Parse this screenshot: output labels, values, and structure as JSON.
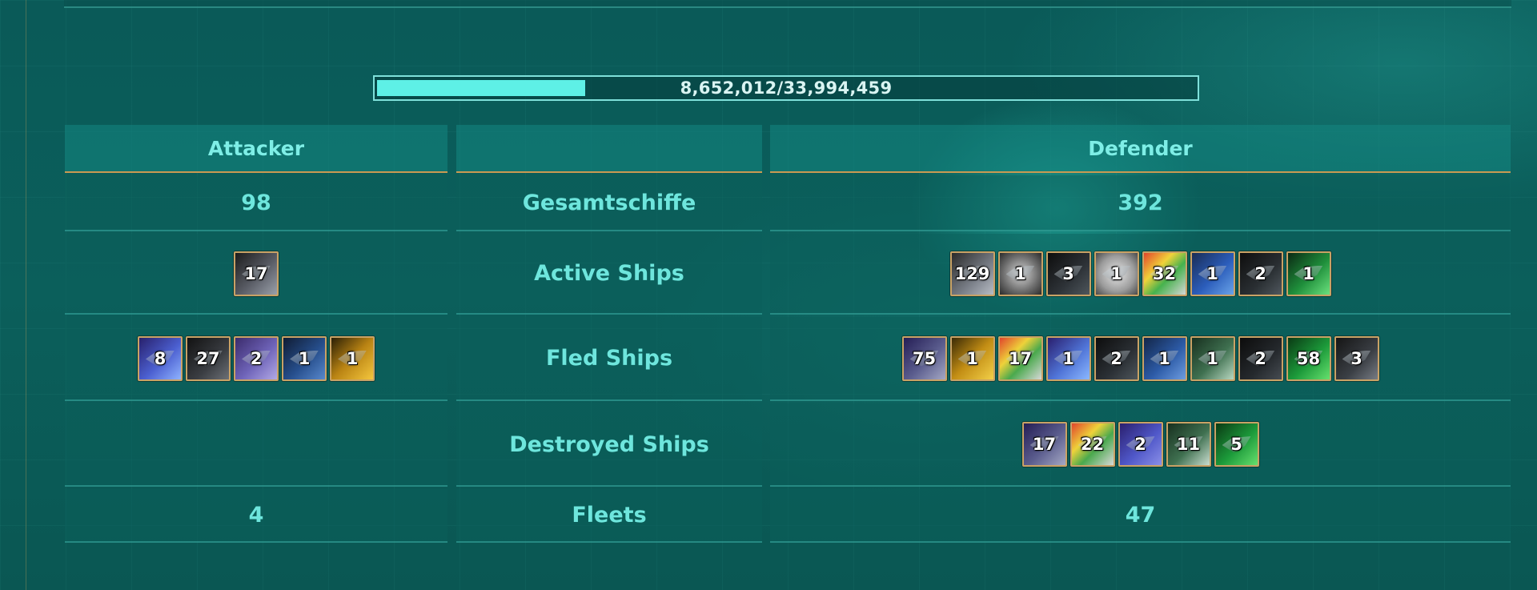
{
  "progress": {
    "text": "8,652,012/33,994,459",
    "fraction": 0.2545
  },
  "headers": {
    "attacker": "Attacker",
    "middle": "",
    "defender": "Defender"
  },
  "rows": {
    "total": {
      "label": "Gesamtschiffe",
      "attacker": "98",
      "defender": "392"
    },
    "active": {
      "label": "Active Ships"
    },
    "fled": {
      "label": "Fled Ships"
    },
    "destroyed": {
      "label": "Destroyed Ships"
    },
    "fleets": {
      "label": "Fleets",
      "attacker": "4",
      "defender": "47"
    }
  },
  "ships": {
    "attacker_active": [
      {
        "count": "17",
        "bg": "linear-gradient(135deg,#1c1c1c,#5a5d66 55%,#9aa0aa)"
      }
    ],
    "defender_active": [
      {
        "count": "129",
        "bg": "linear-gradient(135deg,#2a2a2a,#7a7f88 60%,#b7bcc4)"
      },
      {
        "count": "1",
        "bg": "radial-gradient(circle at 50% 50%,#d7d7d7,#6d6d6d 60%,#2b2b2b)"
      },
      {
        "count": "3",
        "bg": "linear-gradient(135deg,#0d0d0d,#2e3338 60%,#4e565c)"
      },
      {
        "count": "1",
        "bg": "radial-gradient(circle at 50% 50%,#e7e7e7,#9c9c9c 60%,#4a4a4a)"
      },
      {
        "count": "32",
        "bg": "linear-gradient(135deg,#e2452b,#f0d23a 35%,#46b24d 60%,#d6d6d6)"
      },
      {
        "count": "1",
        "bg": "linear-gradient(135deg,#1a2c55,#2b5dbb 55%,#6aa3e8)"
      },
      {
        "count": "2",
        "bg": "linear-gradient(135deg,#0e0e0e,#2a2f33 60%,#50585e)"
      },
      {
        "count": "1",
        "bg": "linear-gradient(135deg,#0b2a14,#1f8f3b 55%,#6be17e)"
      }
    ],
    "attacker_fled": [
      {
        "count": "8",
        "bg": "linear-gradient(135deg,#28206b,#4b5fd0 55%,#8fb3ff)"
      },
      {
        "count": "27",
        "bg": "linear-gradient(135deg,#121212,#3a3d42 60%,#6c7076)"
      },
      {
        "count": "2",
        "bg": "linear-gradient(135deg,#3b2b6c,#6e63b8 55%,#b2a9e6)"
      },
      {
        "count": "1",
        "bg": "linear-gradient(135deg,#101c33,#264e8c 55%,#5888cc)"
      },
      {
        "count": "1",
        "bg": "linear-gradient(135deg,#2a1f06,#b98313 50%,#f4c63d)"
      }
    ],
    "defender_fled": [
      {
        "count": "75",
        "bg": "linear-gradient(135deg,#241d55,#5b5d8e 55%,#a4a8c4)"
      },
      {
        "count": "1",
        "bg": "linear-gradient(135deg,#3a2a06,#c28d14 50%,#f2cf48)"
      },
      {
        "count": "17",
        "bg": "linear-gradient(135deg,#e0452c,#eed23a 35%,#4aa94d 60%,#d8d8d8)"
      },
      {
        "count": "1",
        "bg": "linear-gradient(135deg,#2a1f6e,#4f73d6 55%,#8bb8ff)"
      },
      {
        "count": "2",
        "bg": "linear-gradient(135deg,#0d0d0d,#2b3035 60%,#4e565c)"
      },
      {
        "count": "1",
        "bg": "linear-gradient(135deg,#132648,#2c5aa6 55%,#6d9ce0)"
      },
      {
        "count": "1",
        "bg": "linear-gradient(135deg,#17301f,#3f7050 55%,#b8d7c0)"
      },
      {
        "count": "2",
        "bg": "linear-gradient(135deg,#0c0c0c,#25292d 60%,#464c52)"
      },
      {
        "count": "58",
        "bg": "linear-gradient(135deg,#0a3a14,#1c9a3a 55%,#66e06e)"
      },
      {
        "count": "3",
        "bg": "linear-gradient(135deg,#151515,#3b3f45 60%,#777c84)"
      }
    ],
    "defender_destroyed": [
      {
        "count": "17",
        "bg": "linear-gradient(135deg,#241d55,#5b5d8e 55%,#a4a8c4)"
      },
      {
        "count": "22",
        "bg": "linear-gradient(135deg,#e0452c,#eed23a 35%,#4aa94d 60%,#d8d8d8)"
      },
      {
        "count": "2",
        "bg": "linear-gradient(135deg,#2a1f6e,#4f57c8 55%,#8a8fe8)"
      },
      {
        "count": "11",
        "bg": "linear-gradient(135deg,#17301f,#3f7050 55%,#c9ddcf)"
      },
      {
        "count": "5",
        "bg": "linear-gradient(135deg,#0a3a14,#1c9a3a 55%,#66e06e)"
      }
    ]
  }
}
